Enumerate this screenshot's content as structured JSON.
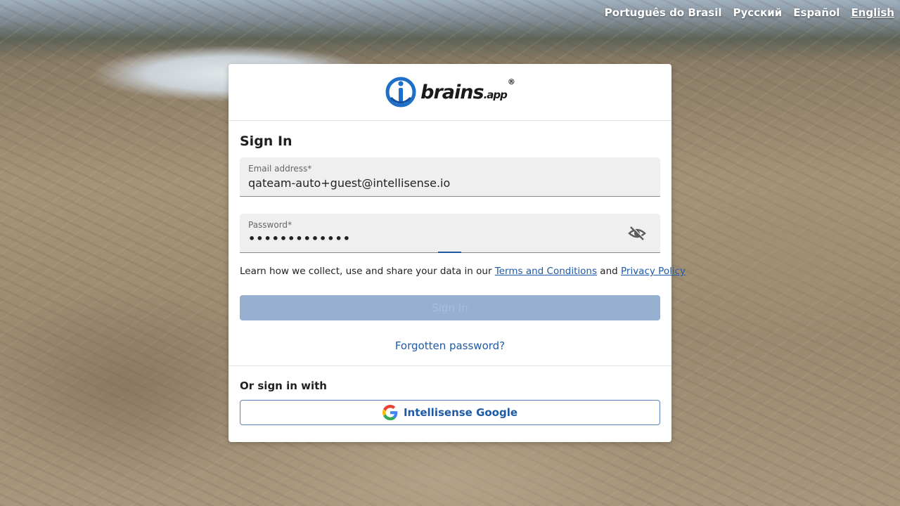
{
  "languages": [
    {
      "label": "Português do Brasil",
      "active": false
    },
    {
      "label": "Русский",
      "active": false
    },
    {
      "label": "Español",
      "active": false
    },
    {
      "label": "English",
      "active": true
    }
  ],
  "logo": {
    "text": "brains",
    "suffix": ".app",
    "mark": "®"
  },
  "form": {
    "title": "Sign In",
    "email": {
      "label": "Email address",
      "required_mark": "*",
      "value": "qateam-auto+guest@intellisense.io"
    },
    "password": {
      "label": "Password",
      "required_mark": "*",
      "value": "•••••••••••••",
      "toggle_icon": "eye-off-icon"
    },
    "terms_prefix": "Learn how we collect, use and share your data in our ",
    "terms_link": "Terms and Conditions",
    "terms_and": " and ",
    "privacy_link": "Privacy Policy",
    "signin_label": "Sign In",
    "forgot_label": "Forgotten password?"
  },
  "alt_signin": {
    "heading": "Or sign in with",
    "google_label": "Intellisense Google",
    "icon": "google-icon"
  },
  "colors": {
    "accent": "#1f5aa6",
    "button_disabled": "#97b0cf"
  }
}
